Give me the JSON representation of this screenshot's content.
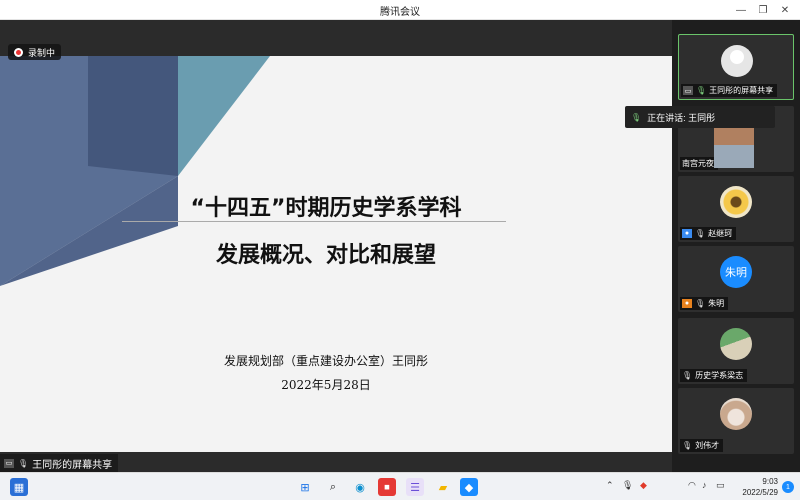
{
  "window": {
    "title": "腾讯会议",
    "min": "—",
    "restore": "❐",
    "close": "✕"
  },
  "recording": {
    "label": "录制中"
  },
  "slide": {
    "title_line1": "“十四五”时期历史学系学科",
    "title_line2": "发展概况、对比和展望",
    "author": "发展规划部（重点建设办公室）王同彤",
    "date": "2022年5月28日"
  },
  "share_label": "王同彤的屏幕共享",
  "speaking": {
    "text": "正在讲话: 王同彤"
  },
  "participants": [
    {
      "name": "王同彤的屏幕共享",
      "avatar": "gray-person"
    },
    {
      "name": "南宫元夜",
      "avatar": "photo"
    },
    {
      "name": "赵继珂",
      "avatar": "flower"
    },
    {
      "name": "朱明",
      "avatar": "朱明"
    },
    {
      "name": "历史学系梁志",
      "avatar": "photo"
    },
    {
      "name": "刘伟才",
      "avatar": "photo"
    }
  ],
  "taskbar": {
    "time": "9:03",
    "date": "2022/5/29",
    "badge": "1",
    "icons": [
      "widgets-icon",
      "windows-start-icon",
      "search-icon",
      "edge-icon",
      "app-red-icon",
      "notes-icon",
      "folder-icon",
      "meeting-icon"
    ]
  },
  "colors": {
    "accent_green": "#6ac46a",
    "brand_blue": "#1a8cff",
    "slide_navy": "#5a6f95",
    "slide_teal": "#6a9db0"
  }
}
